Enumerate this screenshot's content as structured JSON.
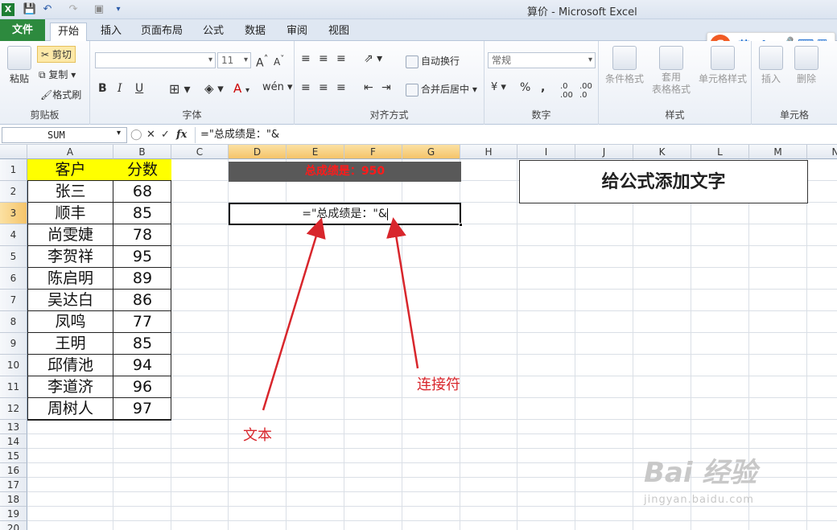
{
  "window": {
    "title": "算价 - Microsoft Excel"
  },
  "tabs": [
    "文件",
    "开始",
    "插入",
    "页面布局",
    "公式",
    "数据",
    "审阅",
    "视图"
  ],
  "ribbon": {
    "clipboard": {
      "label": "剪贴板",
      "paste": "粘贴",
      "cut": "剪切",
      "copy": "复制",
      "format_painter": "格式刷"
    },
    "font": {
      "label": "字体",
      "font_name": "",
      "font_size": "11",
      "bold": "B",
      "italic": "I",
      "underline": "U"
    },
    "alignment": {
      "label": "对齐方式",
      "wrap_text": "自动换行",
      "merge_center": "合并后居中"
    },
    "number": {
      "label": "数字",
      "format": "常规",
      "percent": "%",
      "comma": ","
    },
    "styles": {
      "label": "样式",
      "conditional": "条件格式",
      "table_format_1": "套用",
      "table_format_2": "表格格式",
      "cell_styles": "单元格样式"
    },
    "cells": {
      "label": "单元格",
      "insert": "插入",
      "delete": "删除"
    }
  },
  "ime": {
    "logo": "S",
    "mode": "英"
  },
  "formula_bar": {
    "name_box": "SUM",
    "cancel": "✕",
    "enter": "✓",
    "fx": "fx",
    "formula": "=\"总成绩是：\"&"
  },
  "columns": [
    "A",
    "B",
    "C",
    "D",
    "E",
    "F",
    "G",
    "H",
    "I",
    "J",
    "K",
    "L",
    "M",
    "N"
  ],
  "rows": [
    "1",
    "2",
    "3",
    "4",
    "5",
    "6",
    "7",
    "8",
    "9",
    "10",
    "11",
    "12",
    "13",
    "14",
    "15",
    "16",
    "17",
    "18",
    "19",
    "20"
  ],
  "table": {
    "header_customer": "客户",
    "header_score": "分数",
    "records": [
      {
        "name": "张三",
        "score": "68"
      },
      {
        "name": "顺丰",
        "score": "85"
      },
      {
        "name": "尚雯婕",
        "score": "78"
      },
      {
        "name": "李贺祥",
        "score": "95"
      },
      {
        "name": "陈启明",
        "score": "89"
      },
      {
        "name": "吴达白",
        "score": "86"
      },
      {
        "name": "凤鸣",
        "score": "77"
      },
      {
        "name": "王明",
        "score": "85"
      },
      {
        "name": "邱倩池",
        "score": "94"
      },
      {
        "name": "李道济",
        "score": "96"
      },
      {
        "name": "周树人",
        "score": "97"
      }
    ]
  },
  "cells": {
    "total_display": "总成绩是：950",
    "editing_cell": "=\"总成绩是：\"&",
    "title_box": "给公式添加文字"
  },
  "annotations": {
    "text_label": "文本",
    "connector_label": "连接符",
    "color": "#d8262c"
  },
  "watermark": {
    "brand": "Bai 经验",
    "url": "jingyan.baidu.com"
  },
  "colors": {
    "file_tab": "#2d8a3e",
    "header_fill": "#ffff00",
    "total_bar": "#595959",
    "total_text": "#ff1a1a",
    "selected_header": "#f5c46a"
  }
}
